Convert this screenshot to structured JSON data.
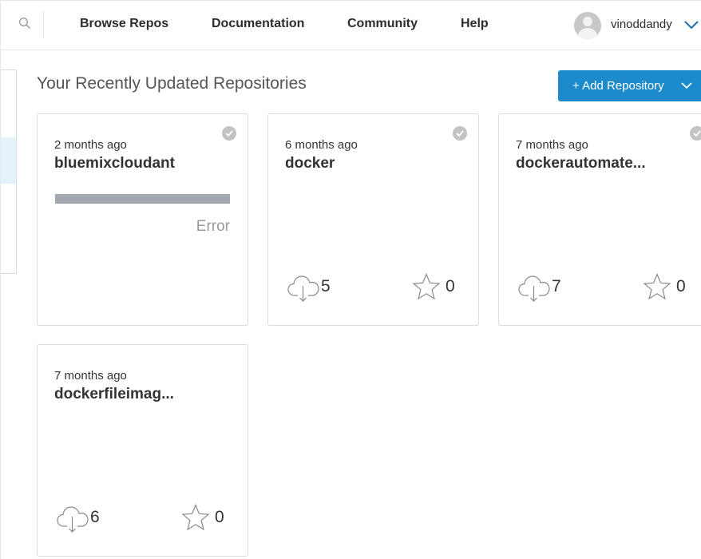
{
  "nav": {
    "search_icon": "search-icon",
    "links": [
      "Browse Repos",
      "Documentation",
      "Community",
      "Help"
    ],
    "username": "vinoddandy"
  },
  "section": {
    "title": "Your Recently Updated Repositories",
    "add_button": "+ Add Repository"
  },
  "repos": [
    {
      "updated": "2 months ago",
      "name": "bluemixcloudant",
      "status": "Error",
      "pulls": "",
      "stars": ""
    },
    {
      "updated": "6 months ago",
      "name": "docker",
      "status": "",
      "pulls": "5",
      "stars": "0"
    },
    {
      "updated": "7 months ago",
      "name": "dockerautomate...",
      "status": "",
      "pulls": "7",
      "stars": "0"
    },
    {
      "updated": "7 months ago",
      "name": "dockerfileimag...",
      "status": "",
      "pulls": "6",
      "stars": "0"
    }
  ],
  "colors": {
    "accent": "#1d8bcb",
    "error_bar": "#a2a8ad",
    "check_badge": "#c3c3c3"
  }
}
